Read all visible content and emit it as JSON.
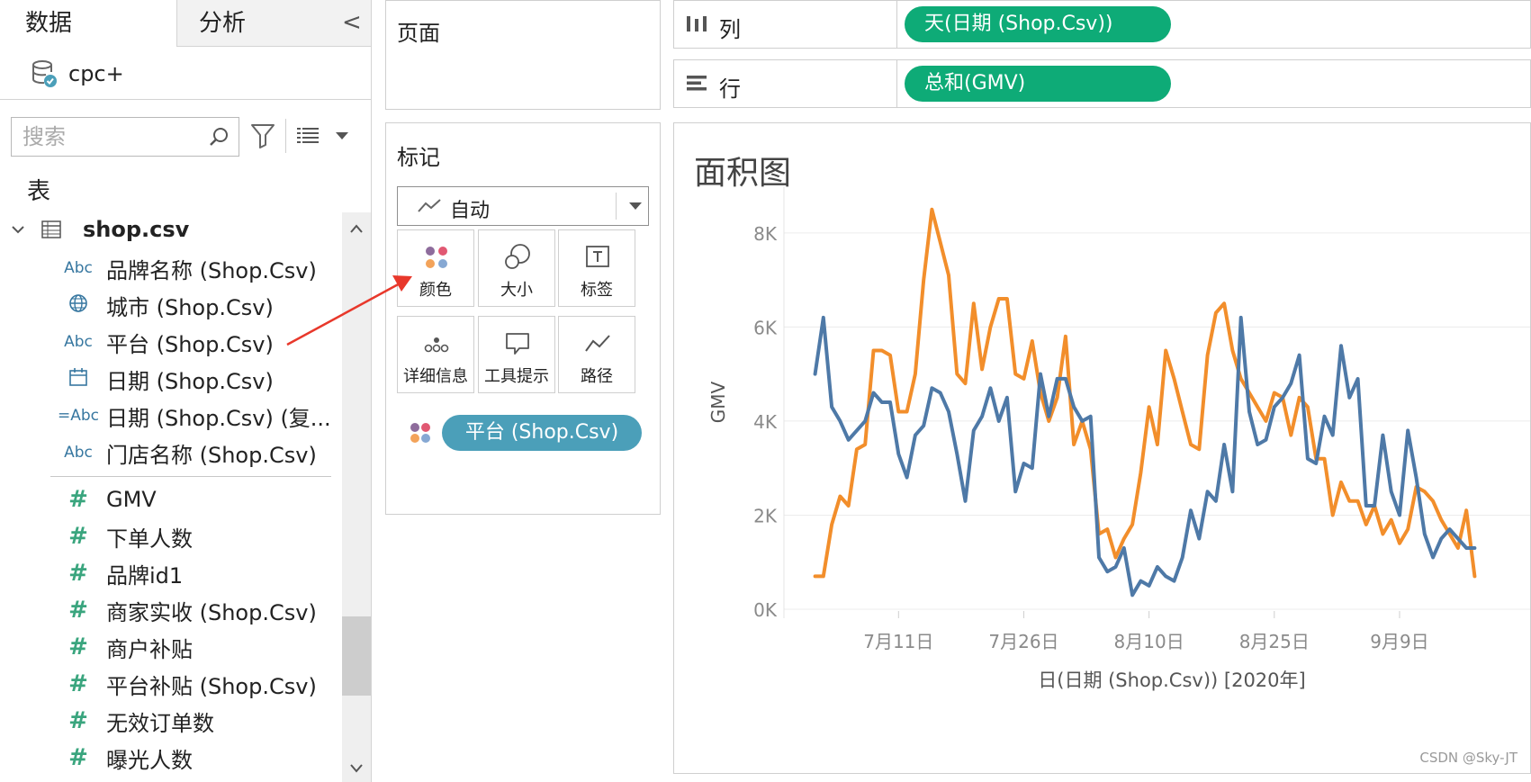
{
  "left_pane": {
    "tabs": {
      "data": "数据",
      "analysis": "分析",
      "collapse": "<"
    },
    "datasource": "cpc+",
    "search_placeholder": "搜索",
    "tables_heading": "表",
    "table_name": "shop.csv",
    "dimensions": [
      {
        "icon": "Abc",
        "label": "品牌名称 (Shop.Csv)"
      },
      {
        "icon": "globe",
        "label": "城市 (Shop.Csv)"
      },
      {
        "icon": "Abc",
        "label": "平台 (Shop.Csv)"
      },
      {
        "icon": "calendar",
        "label": "日期 (Shop.Csv)"
      },
      {
        "icon": "=Abc",
        "label": "日期 (Shop.Csv) (复..."
      },
      {
        "icon": "Abc",
        "label": "门店名称 (Shop.Csv)"
      }
    ],
    "measures": [
      {
        "icon": "#",
        "label": "GMV"
      },
      {
        "icon": "#",
        "label": "下单人数"
      },
      {
        "icon": "#",
        "label": "品牌id1"
      },
      {
        "icon": "#",
        "label": "商家实收 (Shop.Csv)"
      },
      {
        "icon": "#",
        "label": "商户补贴"
      },
      {
        "icon": "#",
        "label": "平台补贴 (Shop.Csv)"
      },
      {
        "icon": "#",
        "label": "无效订单数"
      },
      {
        "icon": "#",
        "label": "曝光人数"
      }
    ]
  },
  "pages": {
    "title": "页面"
  },
  "marks": {
    "title": "标记",
    "mark_type": "自动",
    "buttons": [
      "颜色",
      "大小",
      "标签",
      "详细信息",
      "工具提示",
      "路径"
    ],
    "color_pill": "平台 (Shop.Csv)"
  },
  "shelves": {
    "columns_label": "列",
    "columns_pill": "天(日期 (Shop.Csv))",
    "rows_label": "行",
    "rows_pill": "总和(GMV)"
  },
  "viz": {
    "title": "面积图",
    "watermark": "CSDN @Sky-JT"
  },
  "colors": {
    "orange": "#f28e2b",
    "blue": "#4e79a7",
    "green_pill": "#0eab77",
    "teal_pill": "#4b9fb9"
  },
  "chart_data": {
    "type": "line",
    "ylabel": "GMV",
    "xlabel": "日(日期 (Shop.Csv)) [2020年]",
    "x_start": "2020-06-29",
    "x_end": "2020-09-20",
    "ylim": [
      0,
      8800
    ],
    "y_ticks": [
      0,
      2000,
      4000,
      6000,
      8000
    ],
    "y_tick_labels": [
      "0K",
      "2K",
      "4K",
      "6K",
      "8K"
    ],
    "x_tick_dates": [
      "2020-07-11",
      "2020-07-26",
      "2020-08-10",
      "2020-08-25",
      "2020-09-09"
    ],
    "x_tick_labels": [
      "7月11日",
      "7月26日",
      "8月10日",
      "8月25日",
      "9月9日"
    ],
    "series": [
      {
        "color": "#f28e2b",
        "values": [
          700,
          700,
          1800,
          2400,
          2200,
          3400,
          3500,
          5500,
          5500,
          5400,
          4200,
          4200,
          5000,
          7000,
          8500,
          7800,
          7100,
          5000,
          4800,
          6500,
          5100,
          6000,
          6600,
          6600,
          5000,
          4900,
          5700,
          4600,
          4000,
          4500,
          5800,
          3500,
          4000,
          3400,
          1600,
          1700,
          1100,
          1500,
          1800,
          2900,
          4300,
          3500,
          5500,
          4900,
          4200,
          3500,
          3400,
          5400,
          6300,
          6500,
          5500,
          4900,
          4600,
          4300,
          4000,
          4600,
          4500,
          3700,
          4500,
          4300,
          3200,
          3200,
          2000,
          2700,
          2300,
          2300,
          1800,
          2200,
          1600,
          1900,
          1400,
          1700,
          2600,
          2500,
          2300,
          1900,
          1600,
          1300,
          2100,
          700
        ]
      },
      {
        "color": "#4e79a7",
        "values": [
          5000,
          6200,
          4300,
          4000,
          3600,
          3800,
          4000,
          4600,
          4400,
          4400,
          3300,
          2800,
          3700,
          3900,
          4700,
          4600,
          4200,
          3300,
          2300,
          3800,
          4100,
          4700,
          4000,
          4500,
          2500,
          3100,
          3000,
          5000,
          4100,
          4900,
          4900,
          4300,
          4000,
          4100,
          1100,
          800,
          900,
          1300,
          300,
          600,
          500,
          900,
          700,
          600,
          1100,
          2100,
          1500,
          2500,
          2300,
          3500,
          2500,
          6200,
          4200,
          3500,
          3600,
          4300,
          4500,
          4800,
          5400,
          3200,
          3100,
          4100,
          3700,
          5600,
          4500,
          4900,
          2200,
          2200,
          3700,
          2500,
          2000,
          3800,
          2800,
          1600,
          1100,
          1500,
          1700,
          1500,
          1300,
          1300
        ]
      }
    ]
  }
}
